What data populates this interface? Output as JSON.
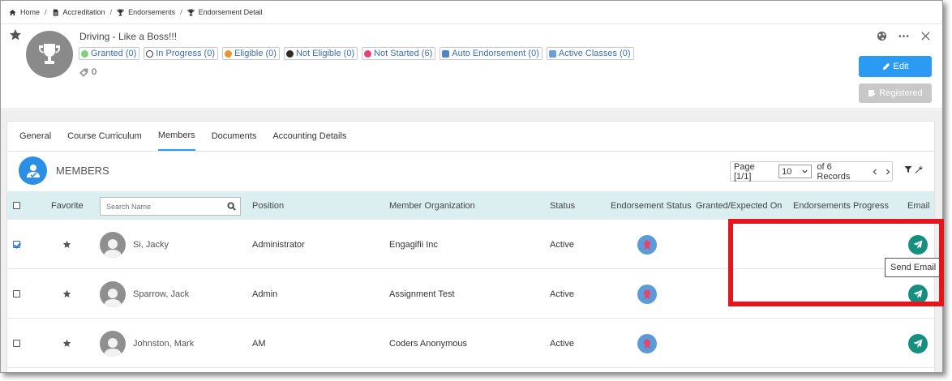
{
  "breadcrumb": {
    "items": [
      {
        "label": "Home",
        "icon": "home-icon"
      },
      {
        "label": "Accreditation",
        "icon": "document-icon"
      },
      {
        "label": "Endorsements",
        "icon": "trophy-icon"
      },
      {
        "label": "Endorsement Detail",
        "icon": "trophy-icon"
      }
    ]
  },
  "header": {
    "title": "Driving - Like a Boss!!!",
    "tag_count": "0",
    "edit_label": "Edit",
    "registered_label": "Registered",
    "chips": [
      {
        "label": "Granted (0)",
        "color": "#7ed07a"
      },
      {
        "label": "In Progress (0)",
        "color": "#ffffff"
      },
      {
        "label": "Eligible (0)",
        "color": "#f0922a"
      },
      {
        "label": "Not Eligible (0)",
        "color": "#2b2b2b"
      },
      {
        "label": "Not Started (6)",
        "color": "#e8407a"
      },
      {
        "label": "Auto Endorsement (0)",
        "color": "#4f86c6"
      },
      {
        "label": "Active Classes (0)",
        "color": "#6aa0d9"
      }
    ]
  },
  "tabs": [
    {
      "label": "General"
    },
    {
      "label": "Course Curriculum"
    },
    {
      "label": "Members"
    },
    {
      "label": "Documents"
    },
    {
      "label": "Accounting Details"
    }
  ],
  "members": {
    "title": "MEMBERS",
    "pager": {
      "page_label": "Page [1/1]",
      "page_size": "10",
      "records": "of 6 Records"
    },
    "search_placeholder": "Search Name",
    "columns": {
      "favorite": "Favorite",
      "position": "Position",
      "organization": "Member Organization",
      "status": "Status",
      "endorsement_status": "Endorsement Status",
      "granted": "Granted/Expected On",
      "progress": "Endorsements Progress",
      "email": "Email"
    },
    "rows": [
      {
        "name": "Si, Jacky",
        "position": "Administrator",
        "organization": "Engagifii Inc",
        "status": "Active",
        "checked": true
      },
      {
        "name": "Sparrow, Jack",
        "position": "Admin",
        "organization": "Assignment Test",
        "status": "Active",
        "checked": false
      },
      {
        "name": "Johnston, Mark",
        "position": "AM",
        "organization": "Coders Anonymous",
        "status": "Active",
        "checked": false
      }
    ]
  },
  "tooltip": {
    "text": "Send Email"
  },
  "colors": {
    "accent": "#2b9af3",
    "email": "#168f7f",
    "highlight": "#e3151d",
    "header_row": "#dbeff1"
  }
}
